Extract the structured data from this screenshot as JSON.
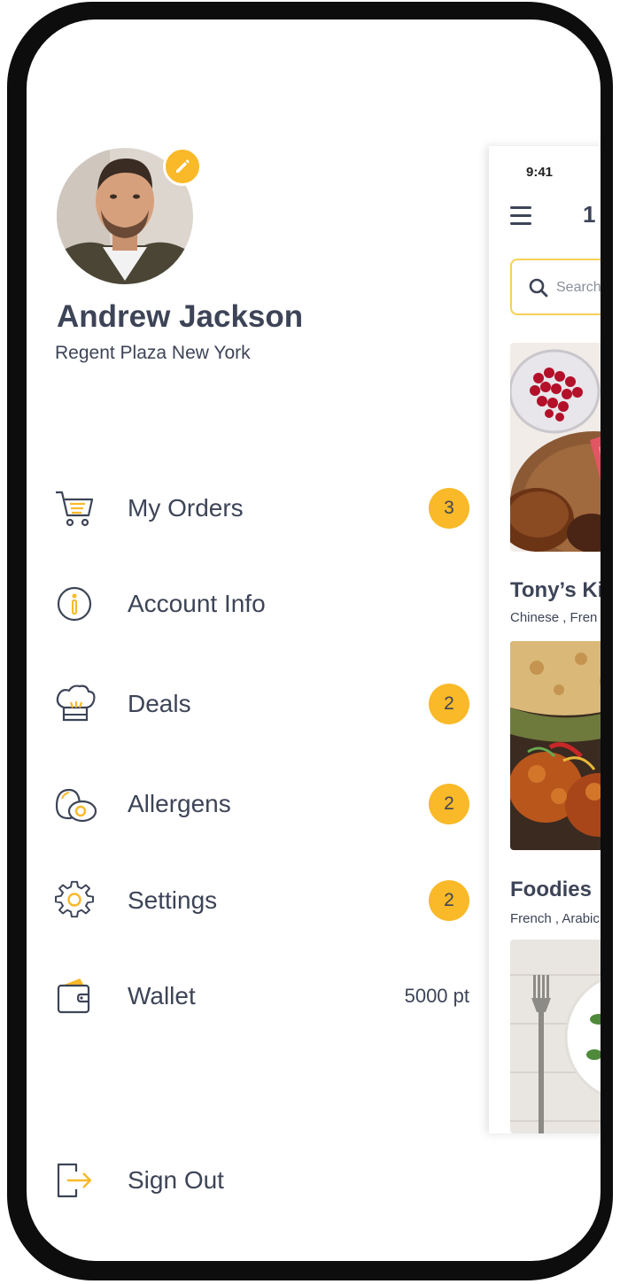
{
  "status": {
    "time": "9:41"
  },
  "main": {
    "header_title": "1",
    "search_placeholder": "Search",
    "restaurants": [
      {
        "name": "Tony’s Ki",
        "tags": "Chinese , Fren"
      },
      {
        "name": "Foodies",
        "tags": "French , Arabic"
      }
    ]
  },
  "profile": {
    "name": "Andrew Jackson",
    "location": "Regent Plaza New York"
  },
  "menu": [
    {
      "label": "My Orders",
      "icon": "cart-icon",
      "badge": "3"
    },
    {
      "label": "Account Info",
      "icon": "info-icon"
    },
    {
      "label": "Deals",
      "icon": "chef-hat-icon",
      "badge": "2"
    },
    {
      "label": "Allergens",
      "icon": "egg-icon",
      "badge": "2"
    },
    {
      "label": "Settings",
      "icon": "gear-icon",
      "badge": "2"
    },
    {
      "label": "Wallet",
      "icon": "wallet-icon",
      "value": "5000 pt"
    }
  ],
  "sign_out": {
    "label": "Sign Out",
    "icon": "sign-out-icon"
  },
  "colors": {
    "accent": "#f9b928",
    "text": "#3d4457",
    "frame": "#0d0d0d"
  }
}
